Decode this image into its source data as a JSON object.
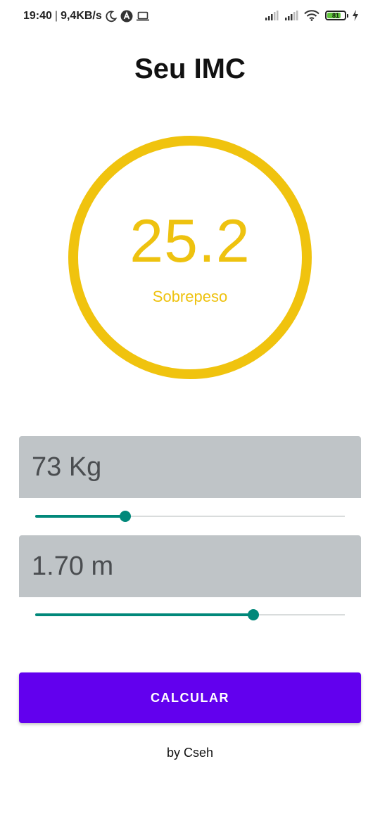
{
  "status_bar": {
    "time": "19:40",
    "separator": "|",
    "network_speed": "9,4KB/s",
    "battery_level": "81",
    "battery_fraction": 0.81,
    "icons_left": [
      "moon-icon",
      "app-a-icon",
      "laptop-icon"
    ],
    "icons_right": [
      "signal-icon",
      "signal-icon",
      "wifi-icon",
      "battery-icon",
      "charging-icon"
    ]
  },
  "header": {
    "title": "Seu IMC"
  },
  "result": {
    "value": "25.2",
    "category": "Sobrepeso",
    "color": "#eec20f"
  },
  "weight": {
    "label": "73 Kg",
    "slider_fraction": 0.29
  },
  "height": {
    "label": "1.70 m",
    "slider_fraction": 0.705
  },
  "actions": {
    "calculate_label": "CALCULAR",
    "button_color": "#6200ee"
  },
  "footer": {
    "credit": "by Cseh"
  },
  "colors": {
    "accent_slider": "#01887a",
    "field_background": "#bfc4c7"
  }
}
